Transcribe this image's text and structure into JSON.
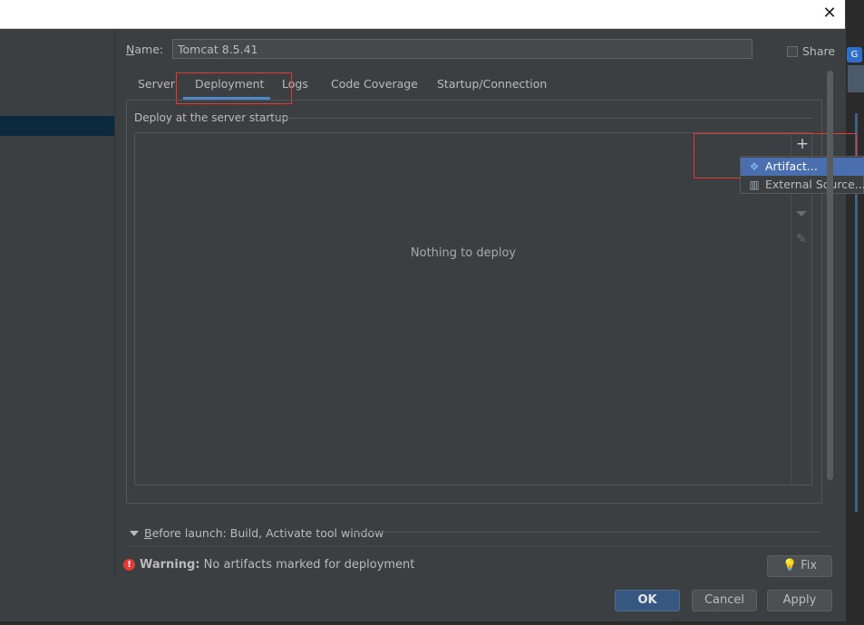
{
  "dialog": {
    "name_label": "Name:",
    "name_value": "Tomcat 8.5.41",
    "share_label": "Share"
  },
  "tabs": [
    {
      "label": "Server"
    },
    {
      "label": "Deployment"
    },
    {
      "label": "Logs"
    },
    {
      "label": "Code Coverage"
    },
    {
      "label": "Startup/Connection"
    }
  ],
  "deployment": {
    "section_title": "Deploy at the server startup",
    "empty_text": "Nothing to deploy",
    "add_symbol": "+",
    "add_menu": [
      {
        "label": "Artifact...",
        "icon": "artifact-icon"
      },
      {
        "label": "External Source...",
        "icon": "external-source-icon"
      }
    ]
  },
  "before_launch": {
    "label_underlined": "B",
    "label_rest": "efore launch: Build, Activate tool window"
  },
  "warning": {
    "title": "Warning:",
    "message": "No artifacts marked for deployment"
  },
  "buttons": {
    "fix": "Fix",
    "ok": "OK",
    "cancel": "Cancel",
    "apply": "Apply"
  },
  "colors": {
    "background": "#3c3f41",
    "accent": "#4a88c7",
    "primary_button": "#365880",
    "highlight_box": "#e53935",
    "menu_selected": "#4b6eaf"
  }
}
